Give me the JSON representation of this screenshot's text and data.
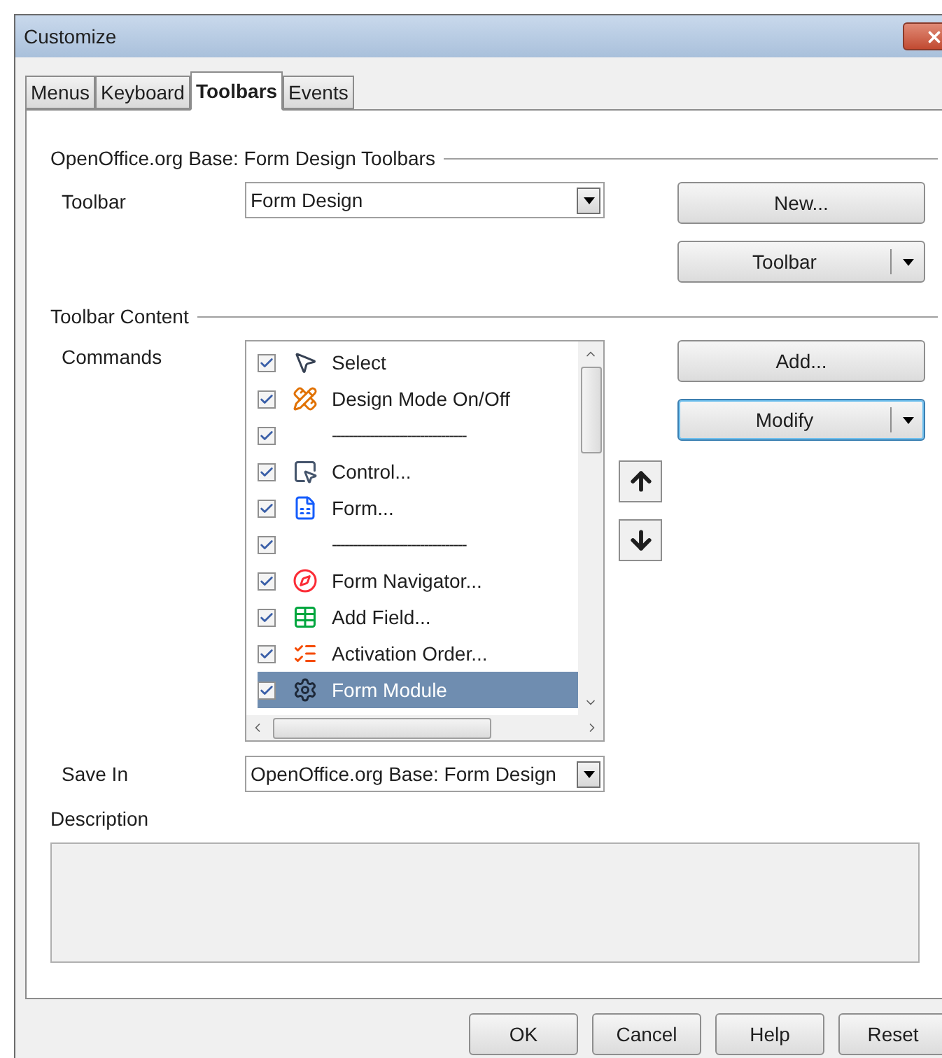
{
  "window": {
    "title": "Customize"
  },
  "tabs": [
    {
      "label": "Menus",
      "selected": false
    },
    {
      "label": "Keyboard",
      "selected": false
    },
    {
      "label": "Toolbars",
      "selected": true
    },
    {
      "label": "Events",
      "selected": false
    }
  ],
  "toolbars_group": {
    "title": "OpenOffice.org Base: Form Design Toolbars",
    "toolbar_label": "Toolbar",
    "toolbar_value": "Form Design",
    "new_button": "New...",
    "toolbar_button": "Toolbar"
  },
  "content_group": {
    "title": "Toolbar Content",
    "commands_label": "Commands",
    "commands": [
      {
        "kind": "command",
        "label": "Select",
        "checked": true,
        "selected": false
      },
      {
        "kind": "command",
        "label": "Design Mode On/Off",
        "checked": true,
        "selected": false
      },
      {
        "kind": "separator",
        "label": "--------------------------------",
        "checked": true,
        "selected": false
      },
      {
        "kind": "command",
        "label": "Control...",
        "checked": true,
        "selected": false
      },
      {
        "kind": "command",
        "label": "Form...",
        "checked": true,
        "selected": false
      },
      {
        "kind": "separator",
        "label": "--------------------------------",
        "checked": true,
        "selected": false
      },
      {
        "kind": "command",
        "label": "Form Navigator...",
        "checked": true,
        "selected": false
      },
      {
        "kind": "command",
        "label": "Add Field...",
        "checked": true,
        "selected": false
      },
      {
        "kind": "command",
        "label": "Activation Order...",
        "checked": true,
        "selected": false
      },
      {
        "kind": "command",
        "label": "Form Module",
        "checked": true,
        "selected": true
      }
    ],
    "add_button": "Add...",
    "modify_button": "Modify",
    "save_in_label": "Save In",
    "save_in_value": "OpenOffice.org Base: Form Design"
  },
  "description": {
    "label": "Description"
  },
  "buttons": [
    "OK",
    "Cancel",
    "Help",
    "Reset"
  ]
}
